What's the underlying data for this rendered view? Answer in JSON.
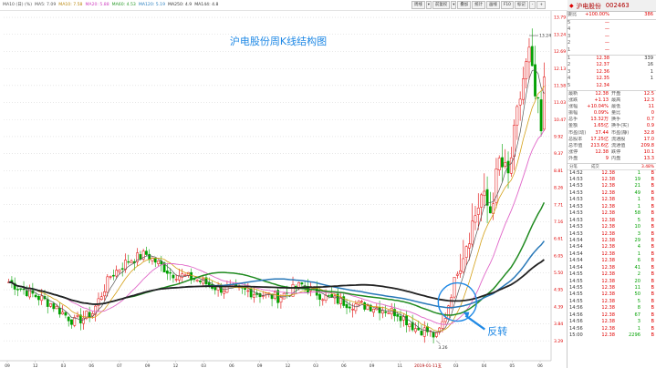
{
  "ma_legend": [
    {
      "text": "MA10 (日) (%)",
      "color": "#555555"
    },
    {
      "text": "MA5: 7.09",
      "color": "#555555"
    },
    {
      "text": "MA10: 7.58",
      "color": "#b8860b"
    },
    {
      "text": "MA20: 5.88",
      "color": "#d040c0"
    },
    {
      "text": "MA60: 4.53",
      "color": "#2a9a2a"
    },
    {
      "text": "MA120: 5.19",
      "color": "#2a7fbf"
    },
    {
      "text": "MA250: 4.9",
      "color": "#333333"
    },
    {
      "text": "MA144: 4.8",
      "color": "#333333"
    }
  ],
  "toolbar": [
    {
      "label": "周线",
      "sel": false,
      "dd": false
    },
    {
      "label": "▾",
      "sel": false,
      "dd": true
    },
    {
      "label": "前复权",
      "sel": false,
      "dd": false
    },
    {
      "label": "▾",
      "sel": false,
      "dd": true
    },
    {
      "label": "叠加",
      "sel": false,
      "dd": false
    },
    {
      "label": "统计",
      "sel": false,
      "dd": false
    },
    {
      "label": "画线",
      "sel": false,
      "dd": false
    },
    {
      "label": "F10",
      "sel": false,
      "dd": false
    },
    {
      "label": "标记",
      "sel": false,
      "dd": false
    },
    {
      "label": "-",
      "sel": false,
      "dd": false
    },
    {
      "label": "+",
      "sel": false,
      "dd": false
    }
  ],
  "chart_data": {
    "type": "candlestick",
    "title": "沪电股份周K线结构图",
    "annotation": "反转",
    "y_ticks": [
      "13.79",
      "13.24",
      "12.69",
      "12.13",
      "11.58",
      "11.03",
      "10.47",
      "9.92",
      "9.37",
      "8.81",
      "8.26",
      "7.71",
      "7.16",
      "6.61",
      "6.05",
      "5.50",
      "4.95",
      "4.39",
      "3.84",
      "3.29"
    ],
    "x_ticks": [
      "09",
      "12",
      "03",
      "06",
      "07",
      "09",
      "12",
      "03",
      "06",
      "09",
      "12",
      "03",
      "06",
      "09",
      "11",
      "2019-01-11五",
      "03",
      "04",
      "05",
      "06"
    ],
    "ylim": [
      3.0,
      14.0
    ],
    "high_label": "13.24",
    "low_label": "3.26",
    "colors": {
      "up": "#e00000",
      "down": "#00a000",
      "ma5": "#555555",
      "ma10": "#d4a017",
      "ma20": "#e066c8",
      "ma60": "#1f8a1f",
      "ma120": "#2878b8",
      "ma250": "#222222"
    }
  },
  "quote": {
    "header": {
      "icon": "◆",
      "title": "沪电股份",
      "code": "002463"
    },
    "commission": [
      {
        "label": "委比",
        "v1": "+100.00%",
        "v2": "386"
      }
    ],
    "sell": [
      {
        "l": "5",
        "p": "—",
        "v": ""
      },
      {
        "l": "4",
        "p": "—",
        "v": ""
      },
      {
        "l": "3",
        "p": "—",
        "v": ""
      },
      {
        "l": "2",
        "p": "—",
        "v": ""
      },
      {
        "l": "1",
        "p": "—",
        "v": ""
      }
    ],
    "buy": [
      {
        "l": "1",
        "p": "12.38",
        "v": "339"
      },
      {
        "l": "2",
        "p": "12.37",
        "v": "16"
      },
      {
        "l": "3",
        "p": "12.36",
        "v": "1"
      },
      {
        "l": "4",
        "p": "12.35",
        "v": "1"
      },
      {
        "l": "5",
        "p": "12.34",
        "v": ""
      }
    ],
    "stats": [
      {
        "l": "最新",
        "v": "12.38",
        "l2": "开盘",
        "v2": "12.5"
      },
      {
        "l": "涨跌",
        "v": "+1.13",
        "l2": "最高",
        "v2": "12.3"
      },
      {
        "l": "涨幅",
        "v": "+10.04%",
        "l2": "最低",
        "v2": "11"
      },
      {
        "l": "振幅",
        "v": "0.09%",
        "l2": "量比",
        "v2": "0"
      },
      {
        "l": "总手",
        "v": "13.32万",
        "l2": "换手",
        "v2": "0.7"
      },
      {
        "l": "金额",
        "v": "1.65亿",
        "l2": "换手(实)",
        "v2": "0.9"
      },
      {
        "l": "市盈(动)",
        "v": "37.44",
        "l2": "市盈(静)",
        "v2": "32.8"
      },
      {
        "l": "总股本",
        "v": "17.25亿",
        "l2": "流通股",
        "v2": "17.0"
      },
      {
        "l": "总市值",
        "v": "213.6亿",
        "l2": "流通值",
        "v2": "209.8"
      },
      {
        "l": "涨停",
        "v": "12.38",
        "l2": "跌停",
        "v2": "10.1"
      },
      {
        "l": "外盘",
        "v": "9",
        "l2": "内盘",
        "v2": "13.3"
      }
    ],
    "trades_head": {
      "a": "分笔",
      "b": "成交",
      "c": "3.48%"
    },
    "trades": [
      {
        "t": "14:52",
        "p": "12.38",
        "v": "1",
        "d": "B"
      },
      {
        "t": "14:53",
        "p": "12.38",
        "v": "19",
        "d": "B"
      },
      {
        "t": "14:53",
        "p": "12.38",
        "v": "21",
        "d": "B"
      },
      {
        "t": "14:53",
        "p": "12.38",
        "v": "49",
        "d": "B"
      },
      {
        "t": "14:53",
        "p": "12.38",
        "v": "1",
        "d": "B"
      },
      {
        "t": "14:53",
        "p": "12.38",
        "v": "1",
        "d": "B"
      },
      {
        "t": "14:53",
        "p": "12.38",
        "v": "58",
        "d": "B"
      },
      {
        "t": "14:53",
        "p": "12.38",
        "v": "5",
        "d": "B"
      },
      {
        "t": "14:53",
        "p": "12.38",
        "v": "10",
        "d": "B"
      },
      {
        "t": "14:53",
        "p": "12.38",
        "v": "3",
        "d": "B"
      },
      {
        "t": "14:54",
        "p": "12.38",
        "v": "29",
        "d": "B"
      },
      {
        "t": "14:54",
        "p": "12.38",
        "v": "4",
        "d": "B"
      },
      {
        "t": "14:54",
        "p": "12.38",
        "v": "1",
        "d": "B"
      },
      {
        "t": "14:54",
        "p": "12.38",
        "v": "6",
        "d": "B"
      },
      {
        "t": "14:54",
        "p": "12.38",
        "v": "41",
        "d": "B"
      },
      {
        "t": "14:55",
        "p": "12.38",
        "v": "2",
        "d": "B"
      },
      {
        "t": "14:55",
        "p": "12.38",
        "v": "20",
        "d": "B"
      },
      {
        "t": "14:55",
        "p": "12.38",
        "v": "11",
        "d": "B"
      },
      {
        "t": "14:55",
        "p": "12.38",
        "v": "50",
        "d": "B"
      },
      {
        "t": "14:55",
        "p": "12.38",
        "v": "5",
        "d": "B"
      },
      {
        "t": "14:56",
        "p": "12.38",
        "v": "8",
        "d": "B"
      },
      {
        "t": "14:56",
        "p": "12.38",
        "v": "67",
        "d": "B"
      },
      {
        "t": "14:56",
        "p": "12.38",
        "v": "3",
        "d": "B"
      },
      {
        "t": "14:56",
        "p": "12.38",
        "v": "1",
        "d": "B"
      },
      {
        "t": "15:00",
        "p": "12.38",
        "v": "2296",
        "d": "B"
      }
    ]
  }
}
